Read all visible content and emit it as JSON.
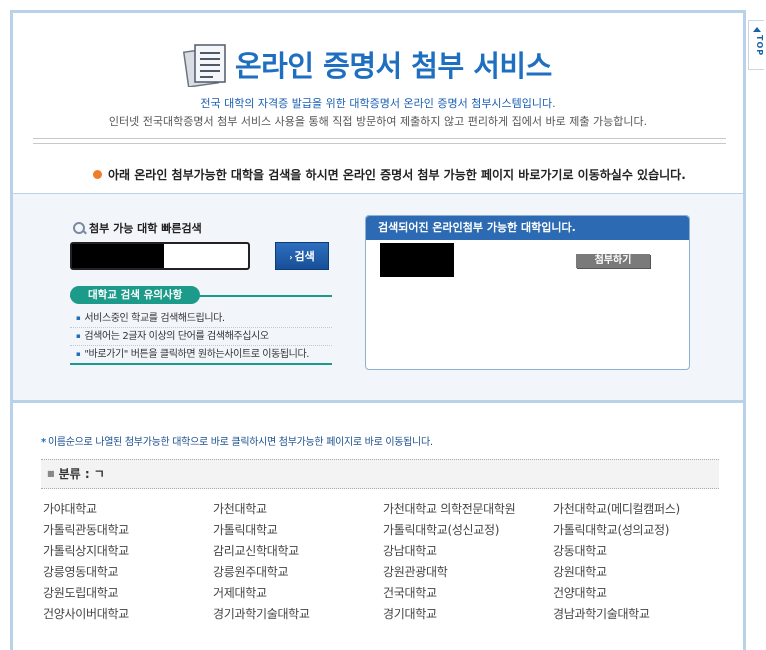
{
  "top_button": "TOP",
  "header": {
    "title": "온라인 증명서 첨부 서비스",
    "subtitle1": "전국 대학의 자격증 발급을 위한 대학증명서 온라인 증명서 첨부시스템입니다.",
    "subtitle2": "인터넷 전국대학증명서 첨부 서비스 사용을 통해 직접 방문하여 제출하지 않고 편리하게 집에서 바로 제출 가능합니다."
  },
  "notice": "아래 온라인 첨부가능한 대학을 검색을 하시면 온라인 증명서 첨부 가능한 페이지 바로가기로 이동하실수 있습니다.",
  "search": {
    "label": "첨부 가능 대학 빠른검색",
    "button": "검색",
    "caution_title": "대학교 검색 유의사항",
    "cautions": [
      "서비스중인 학교를 검색해드립니다.",
      "검색어는 2글자 이상의 단어를 검색해주십시오",
      "\"바로가기\" 버튼을 클릭하면 원하는사이트로 이동됩니다."
    ]
  },
  "results": {
    "header": "검색되어진 온라인첨부 가능한 대학입니다.",
    "attach_button": "첨부하기"
  },
  "list": {
    "notice": "이름순으로 나열된 첨부가능한 대학으로 바로 클릭하시면 첨부가능한 페이지로 바로 이동됩니다.",
    "category": "분류 : ㄱ",
    "universities": [
      "가야대학교",
      "가천대학교",
      "가천대학교 의학전문대학원",
      "가천대학교(메디컬캠퍼스)",
      "가톨릭관동대학교",
      "가톨릭대학교",
      "가톨릭대학교(성신교정)",
      "가톨릭대학교(성의교정)",
      "가톨릭상지대학교",
      "감리교신학대학교",
      "강남대학교",
      "강동대학교",
      "강릉영동대학교",
      "강릉원주대학교",
      "강원관광대학",
      "강원대학교",
      "강원도립대학교",
      "거제대학교",
      "건국대학교",
      "건양대학교",
      "건양사이버대학교",
      "경기과학기술대학교",
      "경기대학교",
      "경남과학기술대학교"
    ]
  }
}
